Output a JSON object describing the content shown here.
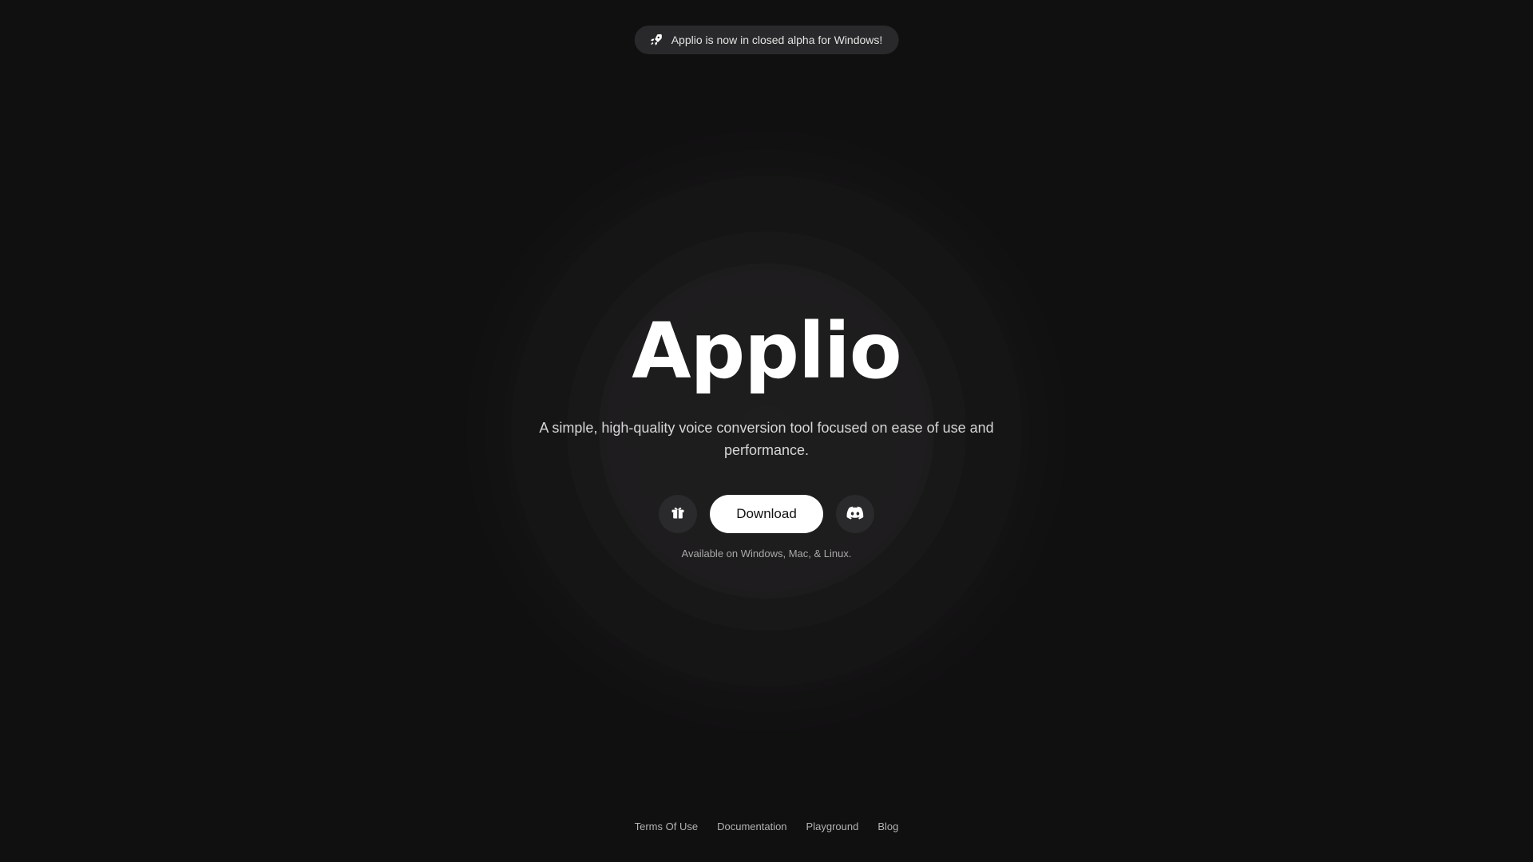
{
  "announcement": {
    "icon": "rocket-icon",
    "text": "Applio is now in closed alpha for Windows!"
  },
  "hero": {
    "title": "Applio",
    "subtitle": "A simple, high-quality voice conversion tool focused on ease of use and performance.",
    "download_label": "Download",
    "gift_icon": "gift-icon",
    "discord_icon": "discord-icon",
    "availability": "Available on Windows, Mac, & Linux."
  },
  "footer": {
    "links": [
      "Terms Of Use",
      "Documentation",
      "Playground",
      "Blog"
    ]
  },
  "colors": {
    "background": "#111011",
    "pill": "#29282a",
    "button_primary": "#ffffff"
  }
}
